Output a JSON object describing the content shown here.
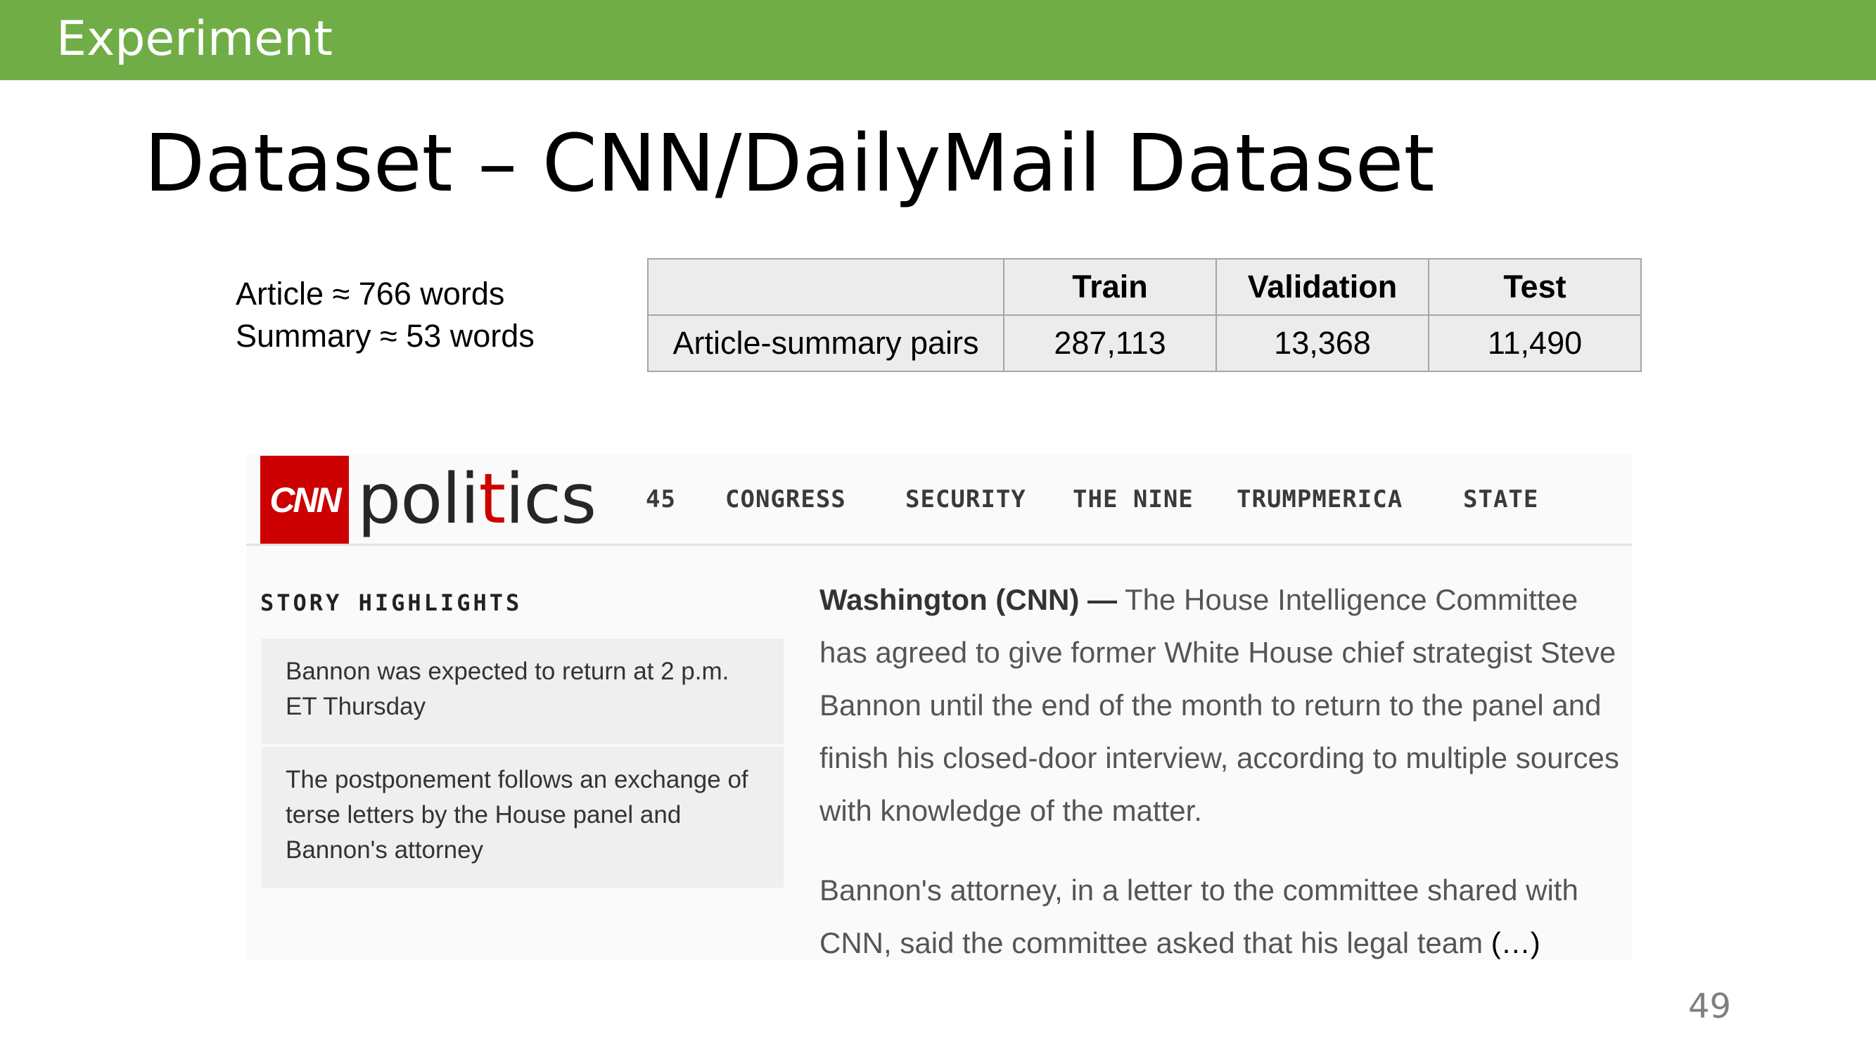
{
  "header": {
    "section": "Experiment"
  },
  "title": "Dataset – CNN/DailyMail Dataset",
  "stats": {
    "article_line": "Article ≈ 766 words",
    "summary_line": "Summary ≈ 53 words"
  },
  "table": {
    "columns": [
      "",
      "Train",
      "Validation",
      "Test"
    ],
    "rows": [
      {
        "label": "Article-summary pairs",
        "train": "287,113",
        "validation": "13,368",
        "test": "11,490"
      }
    ]
  },
  "cnn": {
    "logo_text": "CNN",
    "brand_prefix": "poli",
    "brand_t": "t",
    "brand_suffix": "ics",
    "nav": [
      "45",
      "CONGRESS",
      "SECURITY",
      "THE NINE",
      "TRUMPMERICA",
      "STATE"
    ],
    "highlights_title": "STORY HIGHLIGHTS",
    "highlights": [
      "Bannon was expected to return at 2 p.m. ET Thursday",
      "The postponement follows an exchange of terse letters by the House panel and Bannon's attorney"
    ],
    "dateline": "Washington (CNN) —",
    "paragraph1": " The House Intelligence Committee has agreed to give former White House chief strategist Steve Bannon until the end of the month to return to the panel and finish his closed-door interview, according to multiple sources with knowledge of the matter.",
    "paragraph2": "Bannon's attorney, in a letter to the committee shared with CNN, said the committee asked that his legal team ",
    "ellipsis": "(…)"
  },
  "page_number": "49",
  "colors": {
    "header_bar": "#70ad47",
    "cnn_red": "#cc0000"
  }
}
